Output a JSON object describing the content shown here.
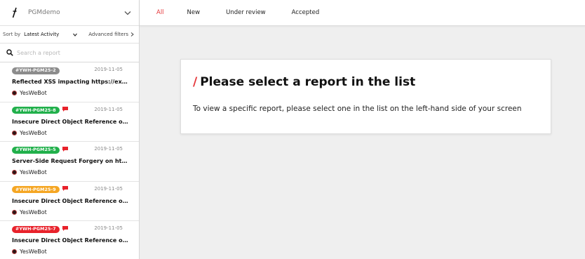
{
  "program": {
    "name": "PGMdemo",
    "logo_icon": "yeswehack-logo-icon"
  },
  "sort": {
    "label": "Sort by",
    "value": "Latest Activity",
    "advanced_filters": "Advanced filters"
  },
  "search": {
    "placeholder": "Search a report",
    "value": ""
  },
  "tabs": [
    {
      "label": "All",
      "active": true
    },
    {
      "label": "New",
      "active": false
    },
    {
      "label": "Under review",
      "active": false
    },
    {
      "label": "Accepted",
      "active": false
    }
  ],
  "reports": [
    {
      "id": "#YWH-PGM25-2",
      "badge_color": "#8c8c8c",
      "has_comment": false,
      "date": "2019-11-05",
      "title": "Reflected XSS impacting https://example.net",
      "author": "YesWeBot"
    },
    {
      "id": "#YWH-PGM25-8",
      "badge_color": "#21b04b",
      "has_comment": true,
      "date": "2019-11-05",
      "title": "Insecure Direct Object Reference on https://...",
      "author": "YesWeBot"
    },
    {
      "id": "#YWH-PGM25-5",
      "badge_color": "#21b04b",
      "has_comment": true,
      "date": "2019-11-05",
      "title": "Server-Side Request Forgery on https://api.e...",
      "author": "YesWeBot"
    },
    {
      "id": "#YWH-PGM25-9",
      "badge_color": "#f5a623",
      "has_comment": true,
      "date": "2019-11-05",
      "title": "Insecure Direct Object Reference on https://...",
      "author": "YesWeBot"
    },
    {
      "id": "#YWH-PGM25-7",
      "badge_color": "#e8222b",
      "has_comment": true,
      "date": "2019-11-05",
      "title": "Insecure Direct Object Reference on https://...",
      "author": "YesWeBot"
    }
  ],
  "empty_state": {
    "slash": "/",
    "title": "Please select a report in the list",
    "text": "To view a specific report, please select one in the list on the left-hand side of your screen"
  },
  "colors": {
    "accent": "#e5373b",
    "comment_icon": "#e8222b"
  }
}
